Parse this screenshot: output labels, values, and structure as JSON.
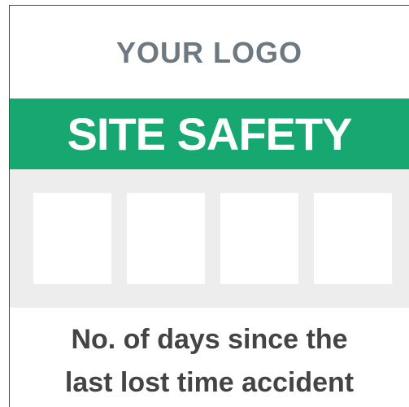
{
  "logo_text": "YOUR LOGO",
  "title": "SITE SAFETY",
  "digits": [
    "",
    "",
    "",
    ""
  ],
  "caption": {
    "line1": "No. of days since the",
    "line2": "last lost time accident"
  },
  "colors": {
    "banner": "#16a870",
    "panel": "#ecedec",
    "logo": "#6d7880"
  }
}
